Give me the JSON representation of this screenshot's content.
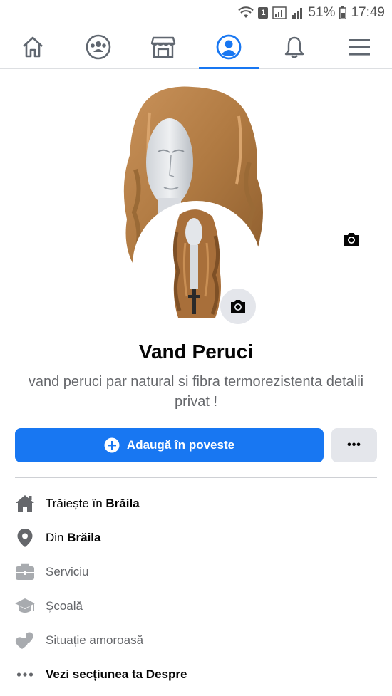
{
  "status_bar": {
    "sim": "1",
    "battery": "51%",
    "time": "17:49"
  },
  "nav": {
    "active": "profile",
    "items": [
      "home",
      "groups",
      "marketplace",
      "profile",
      "notifications",
      "menu"
    ]
  },
  "profile": {
    "name": "Vand Peruci",
    "bio": "vand  peruci par natural si fibra termorezistenta detalii privat !"
  },
  "actions": {
    "add_story_label": "Adaugă în poveste",
    "more_label": "•••"
  },
  "details": {
    "lives_prefix": "Trăiește în ",
    "lives_city": "Brăila",
    "from_prefix": "Din ",
    "from_city": "Brăila",
    "work_label": "Serviciu",
    "school_label": "Școală",
    "relationship_label": "Situație amoroasă",
    "about_label": "Vezi secțiunea ta Despre"
  },
  "colors": {
    "accent": "#1877f2",
    "muted_text": "#65676b",
    "icon_gray": "#65676b",
    "button_gray": "#e4e6eb"
  }
}
